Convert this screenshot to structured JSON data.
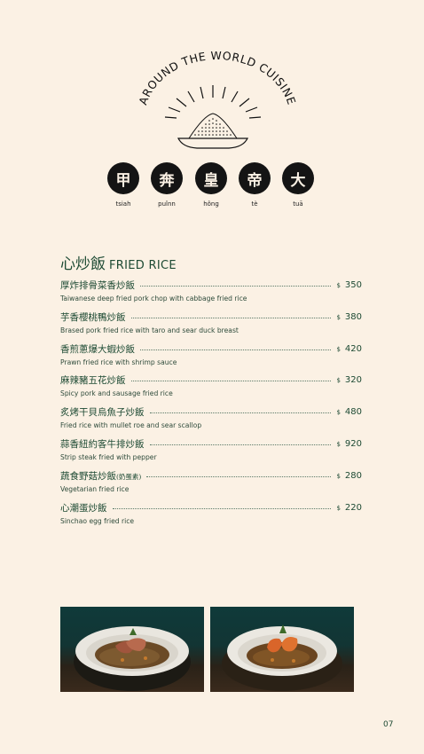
{
  "brand": {
    "name": "AROUND THE WORLD CUISINE"
  },
  "characters": [
    {
      "glyph": "甲",
      "roman": "tsiah"
    },
    {
      "glyph": "奔",
      "roman": "puînn"
    },
    {
      "glyph": "皇",
      "roman": "hông"
    },
    {
      "glyph": "帝",
      "roman": "tè"
    },
    {
      "glyph": "大",
      "roman": "tuā"
    }
  ],
  "section": {
    "zh": "心炒飯",
    "en": "FRIED RICE"
  },
  "currency": "$",
  "items": [
    {
      "zh": "厚炸排骨菜香炒飯",
      "note": "",
      "en": "Taiwanese deep fried pork chop with cabbage fried rice",
      "price": "350"
    },
    {
      "zh": "芋香櫻桃鴨炒飯",
      "note": "",
      "en": "Brased pork fried rice with taro and sear duck breast",
      "price": "380"
    },
    {
      "zh": "香煎蔥爆大蝦炒飯",
      "note": "",
      "en": "Prawn fried rice with shrimp sauce",
      "price": "420"
    },
    {
      "zh": "麻辣豬五花炒飯",
      "note": "",
      "en": "Spicy pork and sausage fried rice",
      "price": "320"
    },
    {
      "zh": "炙烤干貝烏魚子炒飯",
      "note": "",
      "en": "Fried rice with mullet roe and sear scallop",
      "price": "480"
    },
    {
      "zh": "蒜香紐約客牛排炒飯",
      "note": "",
      "en": "Strip steak fried with pepper",
      "price": "920"
    },
    {
      "zh": "蔬食野菇炒飯",
      "note": "(奶蛋素)",
      "en": "Vegetarian fried rice",
      "price": "280"
    },
    {
      "zh": "心潮蛋炒飯",
      "note": "",
      "en": "Sinchao egg fried rice",
      "price": "220"
    }
  ],
  "photos": [
    {
      "subject": "fried-rice-with-sliced-duck"
    },
    {
      "subject": "fried-rice-with-prawns"
    }
  ],
  "page_number": "07"
}
